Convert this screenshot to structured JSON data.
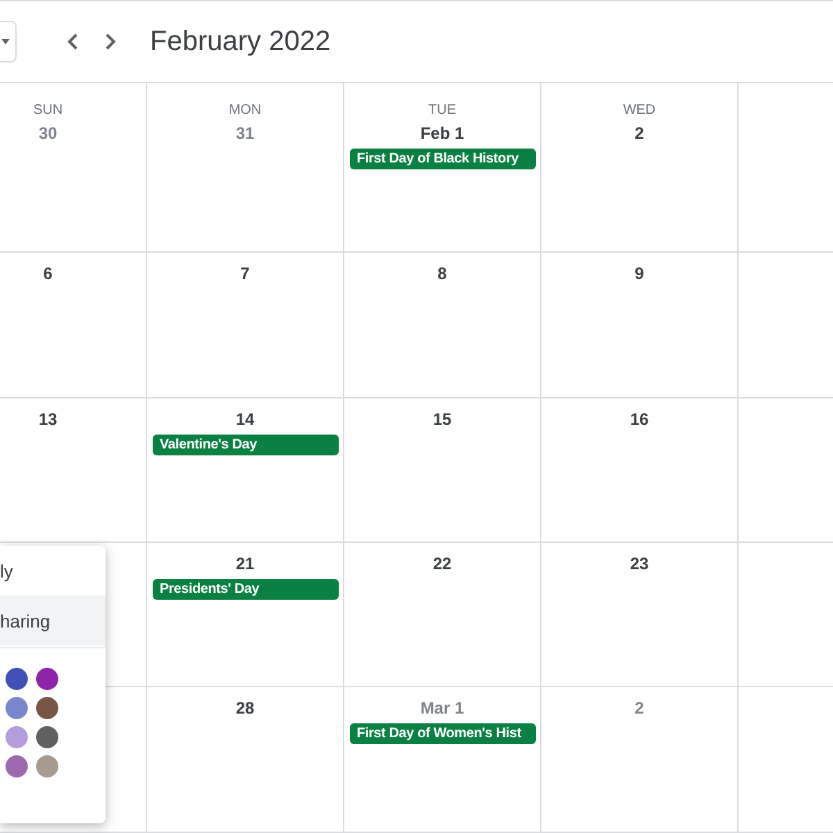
{
  "toolbar": {
    "title": "February 2022"
  },
  "calendar": {
    "weekdays": [
      "SUN",
      "MON",
      "TUE",
      "WED"
    ],
    "weeks": [
      {
        "days": [
          {
            "date": "30",
            "other_month": true
          },
          {
            "date": "31",
            "other_month": true
          },
          {
            "date": "Feb 1",
            "other_month": false,
            "events": [
              {
                "title": "First Day of Black History",
                "color": "#0b8043"
              }
            ]
          },
          {
            "date": "2",
            "other_month": false
          }
        ]
      },
      {
        "days": [
          {
            "date": "6",
            "other_month": false
          },
          {
            "date": "7",
            "other_month": false
          },
          {
            "date": "8",
            "other_month": false
          },
          {
            "date": "9",
            "other_month": false
          }
        ]
      },
      {
        "days": [
          {
            "date": "13",
            "other_month": false
          },
          {
            "date": "14",
            "other_month": false,
            "events": [
              {
                "title": "Valentine's Day",
                "color": "#0b8043"
              }
            ]
          },
          {
            "date": "15",
            "other_month": false
          },
          {
            "date": "16",
            "other_month": false
          }
        ]
      },
      {
        "days": [
          {
            "date": "21",
            "other_month": false,
            "events": [
              {
                "title": "Presidents' Day",
                "color": "#0b8043"
              }
            ]
          },
          {
            "date": "22",
            "other_month": false
          },
          {
            "date": "23",
            "other_month": false
          }
        ]
      },
      {
        "days": [
          {
            "date": "28",
            "other_month": false
          },
          {
            "date": "Mar 1",
            "other_month": true,
            "events": [
              {
                "title": "First Day of Women's Hist",
                "color": "#0b8043"
              }
            ]
          },
          {
            "date": "2",
            "other_month": true
          }
        ]
      }
    ]
  },
  "menu": {
    "items": [
      {
        "label": "ly",
        "selected": false
      },
      {
        "label": "haring",
        "selected": true
      }
    ],
    "swatches": [
      {
        "color": "#3f51b5"
      },
      {
        "color": "#8e24aa"
      },
      {
        "color": "#7986cb"
      },
      {
        "color": "#795548"
      },
      {
        "color": "#b39ddb"
      },
      {
        "color": "#616161"
      },
      {
        "color": "#9e69af"
      },
      {
        "color": "#a79b8e"
      }
    ]
  }
}
